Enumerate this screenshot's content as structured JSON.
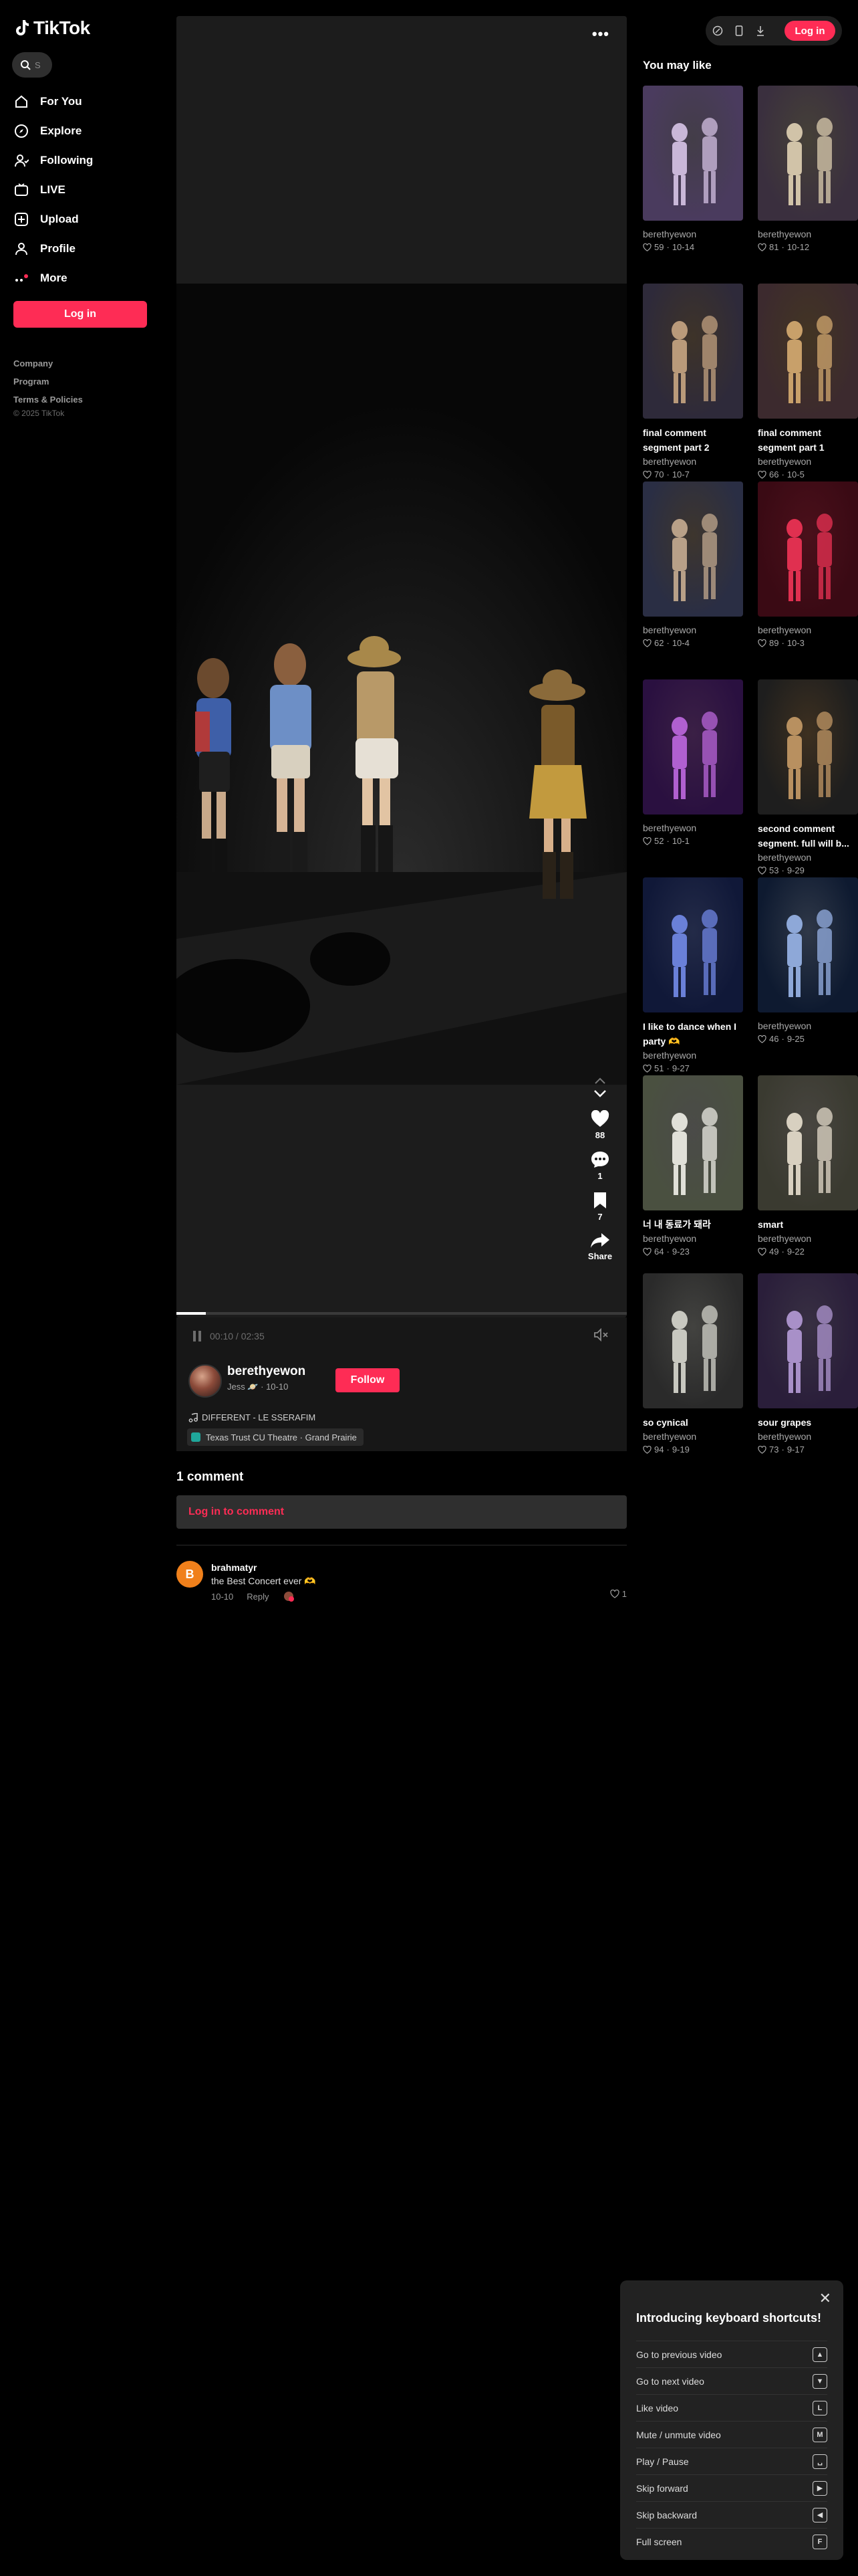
{
  "app": {
    "logo_text": "TikTok"
  },
  "search": {
    "hint": "S"
  },
  "nav": {
    "items": [
      {
        "label": "For You",
        "icon": "home-icon"
      },
      {
        "label": "Explore",
        "icon": "compass-icon"
      },
      {
        "label": "Following",
        "icon": "following-icon"
      },
      {
        "label": "LIVE",
        "icon": "live-icon"
      },
      {
        "label": "Upload",
        "icon": "upload-icon"
      },
      {
        "label": "Profile",
        "icon": "profile-icon"
      },
      {
        "label": "More",
        "icon": "more-icon"
      }
    ],
    "login_label": "Log in"
  },
  "footer": {
    "links": [
      "Company",
      "Program",
      "Terms & Policies"
    ],
    "copyright": "© 2025 TikTok"
  },
  "topbar": {
    "login_label": "Log in"
  },
  "video": {
    "actions": [
      {
        "name": "like",
        "count": "88"
      },
      {
        "name": "comment",
        "count": "1"
      },
      {
        "name": "bookmark",
        "count": "7"
      },
      {
        "name": "share",
        "count": "Share"
      }
    ],
    "time": "00:10 / 02:35",
    "progress": 0.065
  },
  "author": {
    "name": "berethyewon",
    "sub": "Jess 🪐 · 10-10",
    "follow_label": "Follow",
    "music": "DIFFERENT - LE SSERAFIM",
    "location": "Texas Trust CU Theatre · Grand Prairie"
  },
  "comments": {
    "title": "1 comment",
    "input_label": "Log in to comment",
    "items": [
      {
        "avatar_letter": "B",
        "user": "brahmatyr",
        "text": "the Best Concert ever 🫶",
        "date": "10-10",
        "reply_label": "Reply",
        "likes": "1"
      }
    ]
  },
  "you_may_like": {
    "title": "You may like",
    "cards": [
      {
        "title": "",
        "author": "berethyewon",
        "likes": "59",
        "date": "10-14"
      },
      {
        "title": "",
        "author": "berethyewon",
        "likes": "81",
        "date": "10-12"
      },
      {
        "title": "final comment segment part 2",
        "author": "berethyewon",
        "likes": "70",
        "date": "10-7"
      },
      {
        "title": "final comment segment part 1",
        "author": "berethyewon",
        "likes": "66",
        "date": "10-5"
      },
      {
        "title": "",
        "author": "berethyewon",
        "likes": "62",
        "date": "10-4"
      },
      {
        "title": "",
        "author": "berethyewon",
        "likes": "89",
        "date": "10-3"
      },
      {
        "title": "",
        "author": "berethyewon",
        "likes": "52",
        "date": "10-1"
      },
      {
        "title": "second comment segment. full will b...",
        "author": "berethyewon",
        "likes": "53",
        "date": "9-29"
      },
      {
        "title": "I like to dance when I party 🫶",
        "author": "berethyewon",
        "likes": "51",
        "date": "9-27"
      },
      {
        "title": "",
        "author": "berethyewon",
        "likes": "46",
        "date": "9-25"
      },
      {
        "title": "너 내 동료가 돼라",
        "author": "berethyewon",
        "likes": "64",
        "date": "9-23"
      },
      {
        "title": "smart",
        "author": "berethyewon",
        "likes": "49",
        "date": "9-22"
      },
      {
        "title": "so cynical",
        "author": "berethyewon",
        "likes": "94",
        "date": "9-19"
      },
      {
        "title": "sour grapes",
        "author": "berethyewon",
        "likes": "73",
        "date": "9-17"
      }
    ]
  },
  "shortcuts": {
    "title": "Introducing keyboard shortcuts!",
    "items": [
      {
        "label": "Go to previous video",
        "key": "▲"
      },
      {
        "label": "Go to next video",
        "key": "▼"
      },
      {
        "label": "Like video",
        "key": "L"
      },
      {
        "label": "Mute / unmute video",
        "key": "M"
      },
      {
        "label": "Play / Pause",
        "key": "␣"
      },
      {
        "label": "Skip forward",
        "key": "▶"
      },
      {
        "label": "Skip backward",
        "key": "◀"
      },
      {
        "label": "Full screen",
        "key": "F"
      }
    ]
  },
  "colors": {
    "accent": "#fe2c55",
    "background": "#000000",
    "panel": "#171717"
  }
}
